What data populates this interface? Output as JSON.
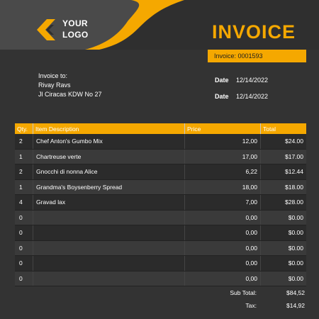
{
  "header": {
    "logo_line1": "YOUR",
    "logo_line2": "LOGO",
    "title": "INVOICE",
    "invoice_number": "Invoice: 0001593",
    "accent_color": "#f5a800",
    "logo_icon": "chevron-left-icon"
  },
  "bill_to": {
    "label": "Invoice to:",
    "name": "Rivay Ravs",
    "address": "Jl Ciracas KDW No 27"
  },
  "dates": [
    {
      "label": "Date",
      "value": "12/14/2022"
    },
    {
      "label": "Date",
      "value": "12/14/2022"
    }
  ],
  "table": {
    "headers": {
      "qty": "Qty.",
      "desc": "Item Description",
      "price": "Price",
      "total": "Total"
    },
    "rows": [
      {
        "qty": "2",
        "desc": "Chef Anton's Gumbo Mix",
        "price": "12,00",
        "total": "$24.00"
      },
      {
        "qty": "1",
        "desc": "Chartreuse verte",
        "price": "17,00",
        "total": "$17.00"
      },
      {
        "qty": "2",
        "desc": "Gnocchi di nonna Alice",
        "price": "6,22",
        "total": "$12.44"
      },
      {
        "qty": "1",
        "desc": "Grandma's Boysenberry Spread",
        "price": "18,00",
        "total": "$18.00"
      },
      {
        "qty": "4",
        "desc": "Gravad lax",
        "price": "7,00",
        "total": "$28.00"
      },
      {
        "qty": "0",
        "desc": "",
        "price": "0,00",
        "total": "$0.00"
      },
      {
        "qty": "0",
        "desc": "",
        "price": "0,00",
        "total": "$0.00"
      },
      {
        "qty": "0",
        "desc": "",
        "price": "0,00",
        "total": "$0.00"
      },
      {
        "qty": "0",
        "desc": "",
        "price": "0,00",
        "total": "$0.00"
      },
      {
        "qty": "0",
        "desc": "",
        "price": "0,00",
        "total": "$0.00"
      }
    ]
  },
  "totals": {
    "subtotal_label": "Sub Total:",
    "subtotal_value": "$84,52",
    "tax_label": "Tax:",
    "tax_value": "$14,92"
  }
}
